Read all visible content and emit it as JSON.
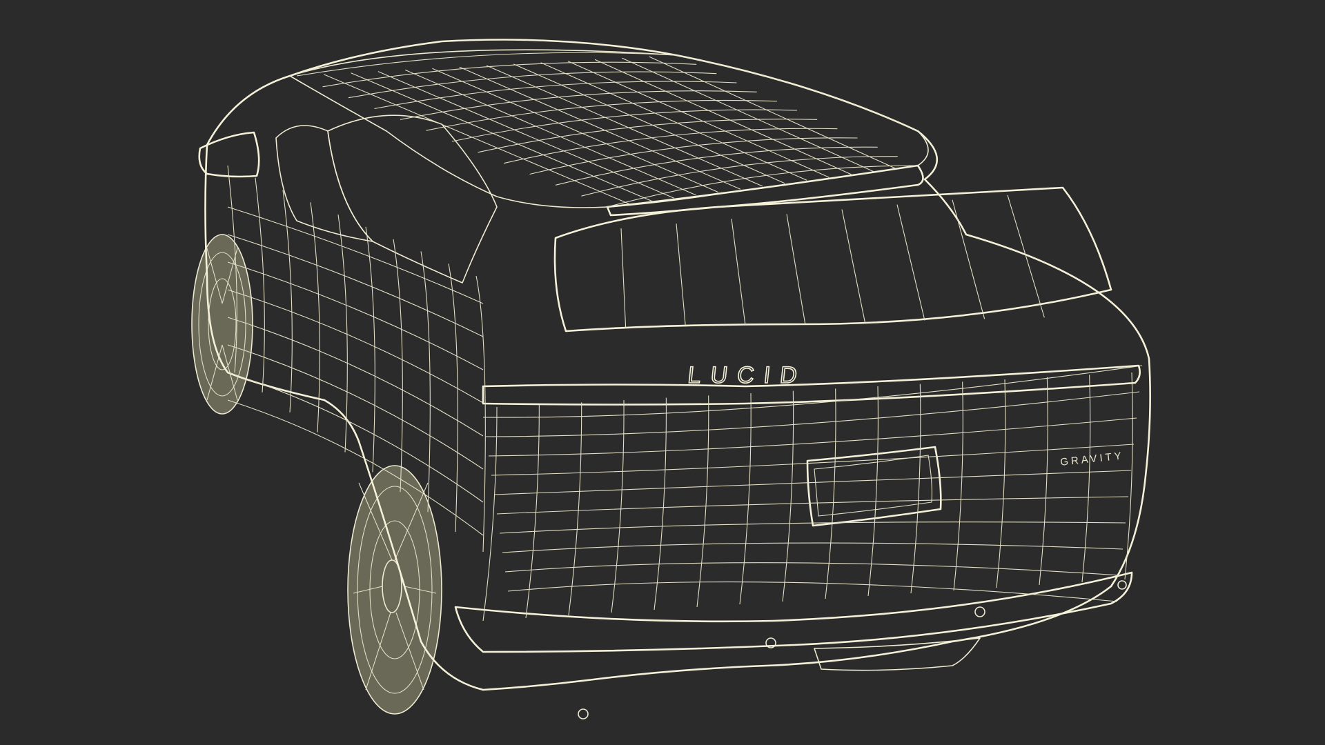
{
  "scene": {
    "background_color": "#2b2b2b",
    "model_fill_color": "#7b7a69",
    "wire_color": "#efebd2"
  },
  "vehicle": {
    "rear_emblem": "LUCID",
    "model_badge": "GRAVITY"
  }
}
